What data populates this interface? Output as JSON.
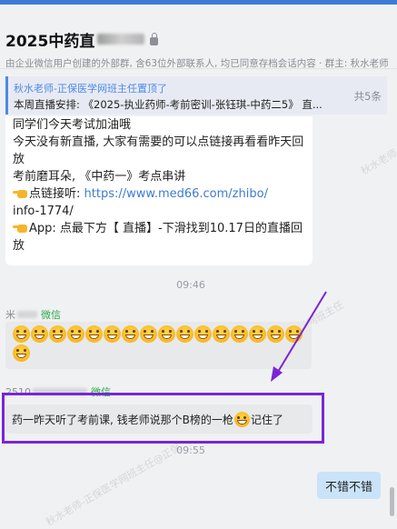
{
  "header": {
    "title": "2025中药直",
    "subtitle": "由企业微信用户创建的外部群, 含63位外部联系人, 均已同意存档会话内容 · 群主: 秋水老师"
  },
  "pinned": {
    "line1": "秋水老师-正保医学网班主任置顶了",
    "line2": "本周直播安排: 《2025-执业药师-考前密训-张钰琪-中药二5》 直...",
    "count": "共5条"
  },
  "messages": {
    "msg1": {
      "line1": "同学们今天考试加油哦",
      "line2": "今天没有新直播, 大家有需要的可以点链接再看看昨天回",
      "line3": "放",
      "line4": "考前磨耳朵, 《中药一》考点串讲",
      "link_label": "点链接听: ",
      "link_url_1": "https://www.med66.com/zhibo/",
      "link_url_2": "info-1774/",
      "app_line": "App: 点最下方【 直播】-下滑找到10.17日的直播回",
      "app_line_2": "放"
    },
    "time1": "09:46",
    "msg2": {
      "sender": "米",
      "tag": "微信",
      "emoji_count": 17
    },
    "msg3": {
      "sender": "2510",
      "tag": "微信",
      "text_before": "药一昨天听了考前课, 钱老师说那个B榜的一枪",
      "text_after": "记住了"
    },
    "time2": "09:55",
    "mine": {
      "text": "不错不错"
    }
  },
  "annotation": {
    "box_color": "#7a25d6",
    "arrow_color": "#7a25d6"
  },
  "watermark": "秋水老师-正保医学网班主任@正保医学网"
}
